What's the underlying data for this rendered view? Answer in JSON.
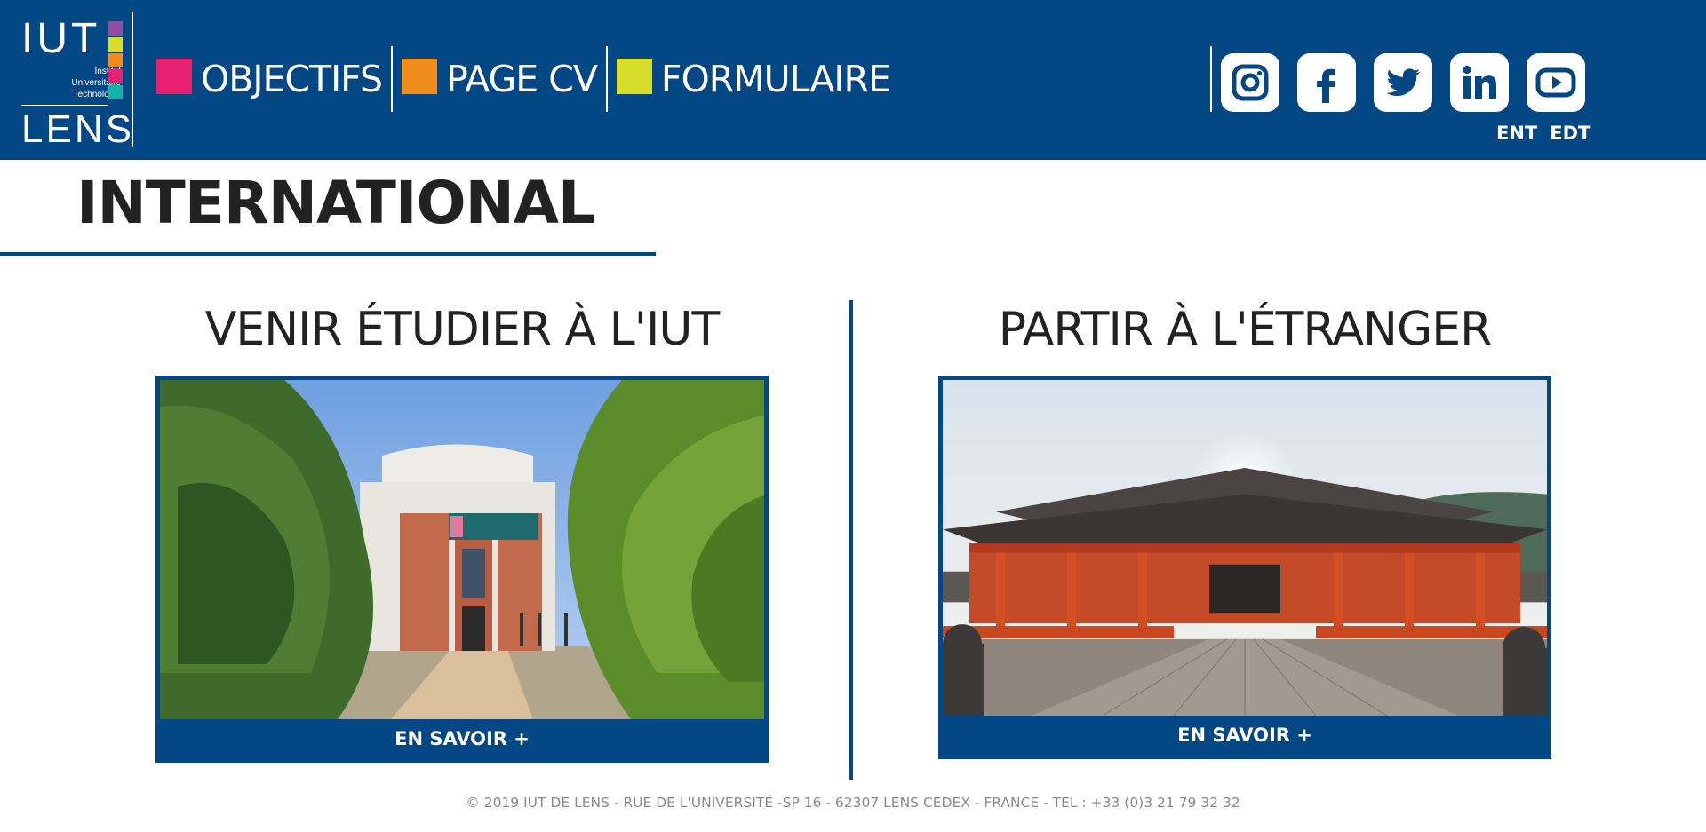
{
  "header": {
    "logo": {
      "top": "IUT",
      "sub_lines": [
        "Institut",
        "Universitaire",
        "Technologie"
      ],
      "bottom": "LENS",
      "square_colors": [
        "#8e4fa1",
        "#d8dd2b",
        "#f08c1a",
        "#e7206f",
        "#14b3a8"
      ]
    },
    "nav": [
      {
        "label": "OBJECTIFS",
        "color": "#e7206f"
      },
      {
        "label": "PAGE CV",
        "color": "#f08c1a"
      },
      {
        "label": "FORMULAIRE",
        "color": "#d8dd2b"
      }
    ],
    "socials": [
      {
        "name": "instagram-icon"
      },
      {
        "name": "facebook-icon"
      },
      {
        "name": "twitter-icon"
      },
      {
        "name": "linkedin-icon"
      },
      {
        "name": "youtube-icon"
      }
    ],
    "quick_links": [
      "ENT",
      "EDT"
    ]
  },
  "page": {
    "title": "INTERNATIONAL"
  },
  "cards": [
    {
      "heading": "VENIR ÉTUDIER À L'IUT",
      "button": "EN SAVOIR +"
    },
    {
      "heading": "PARTIR À L'ÉTRANGER",
      "button": "EN SAVOIR +"
    }
  ],
  "footer": {
    "text": "© 2019 IUT DE LENS - RUE DE L'UNIVERSITÉ -SP 16 - 62307 LENS CEDEX - FRANCE - TEL : +33 (0)3 21 79 32 32"
  },
  "colors": {
    "brand_blue": "#044785"
  }
}
